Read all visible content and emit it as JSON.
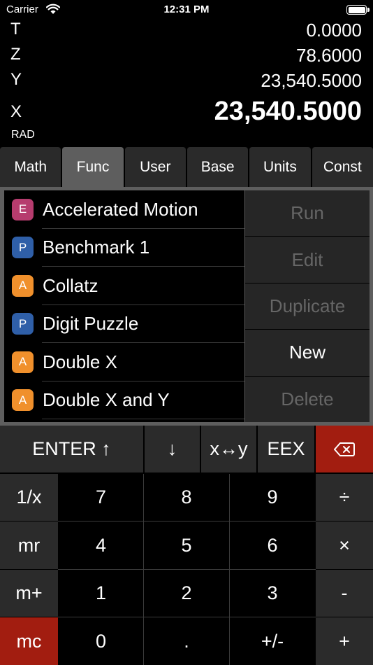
{
  "status_bar": {
    "carrier": "Carrier",
    "time": "12:31 PM"
  },
  "stack": {
    "t": {
      "label": "T",
      "value": "0.0000"
    },
    "z": {
      "label": "Z",
      "value": "78.6000"
    },
    "y": {
      "label": "Y",
      "value": "23,540.5000"
    },
    "x": {
      "label": "X",
      "value": "23,540.5000"
    },
    "angle_mode": "RAD"
  },
  "tabs": [
    {
      "label": "Math",
      "active": false
    },
    {
      "label": "Func",
      "active": true
    },
    {
      "label": "User",
      "active": false
    },
    {
      "label": "Base",
      "active": false
    },
    {
      "label": "Units",
      "active": false
    },
    {
      "label": "Const",
      "active": false
    }
  ],
  "programs": [
    {
      "badge": "E",
      "badge_color": "#b63c6e",
      "name": "Accelerated Motion"
    },
    {
      "badge": "P",
      "badge_color": "#2f5fa8",
      "name": "Benchmark 1"
    },
    {
      "badge": "A",
      "badge_color": "#f0902c",
      "name": "Collatz"
    },
    {
      "badge": "P",
      "badge_color": "#2f5fa8",
      "name": "Digit Puzzle"
    },
    {
      "badge": "A",
      "badge_color": "#f0902c",
      "name": "Double X"
    },
    {
      "badge": "A",
      "badge_color": "#f0902c",
      "name": "Double X and Y"
    }
  ],
  "actions": [
    {
      "label": "Run",
      "enabled": false
    },
    {
      "label": "Edit",
      "enabled": false
    },
    {
      "label": "Duplicate",
      "enabled": false
    },
    {
      "label": "New",
      "enabled": true
    },
    {
      "label": "Delete",
      "enabled": false
    }
  ],
  "keys": {
    "enter": "ENTER ↑",
    "roll_down": "↓",
    "swap": "x↔y",
    "eex": "EEX",
    "backspace": "⌫",
    "reciprocal": "1/x",
    "mr": "mr",
    "m_plus": "m+",
    "mc": "mc",
    "divide": "÷",
    "multiply": "×",
    "subtract": "-",
    "add": "+",
    "d7": "7",
    "d8": "8",
    "d9": "9",
    "d4": "4",
    "d5": "5",
    "d6": "6",
    "d1": "1",
    "d2": "2",
    "d3": "3",
    "d0": "0",
    "decimal": ".",
    "change_sign": "+/-"
  },
  "colors": {
    "accent_red": "#a21d10",
    "active_tab": "#5e5e5e"
  }
}
